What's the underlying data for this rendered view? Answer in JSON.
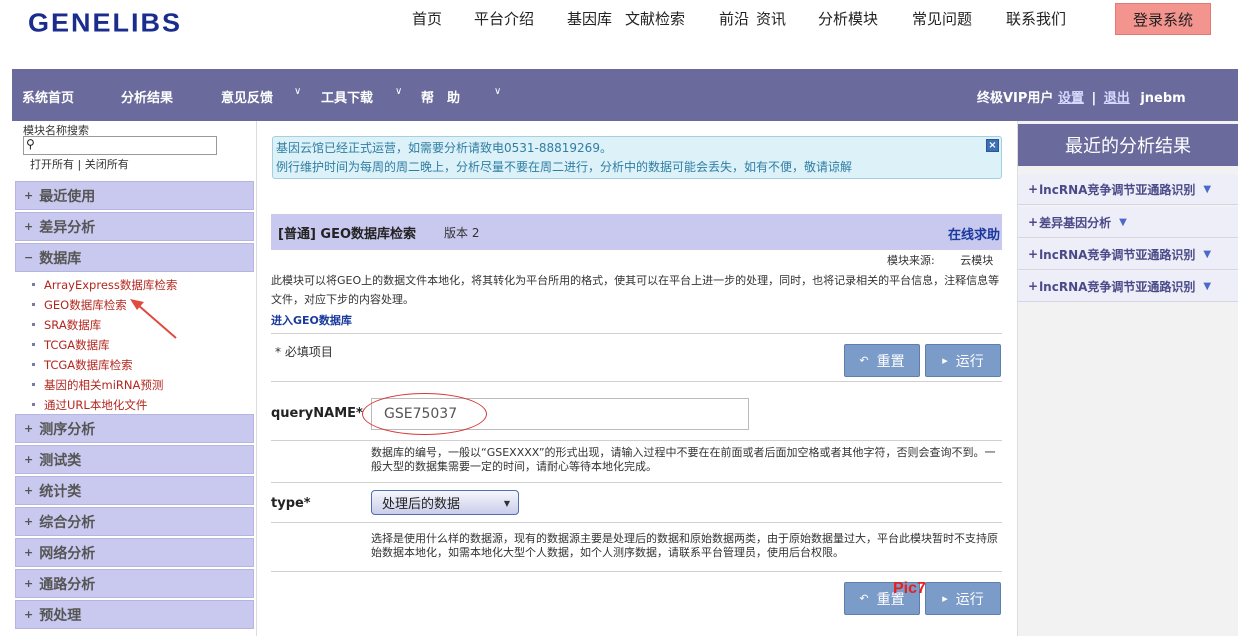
{
  "header": {
    "logo": "GENELIBS",
    "nav": [
      "首页",
      "平台介绍",
      "基因库",
      "文献检索",
      "前沿",
      "资讯",
      "分析模块",
      "常见问题",
      "联系我们"
    ],
    "login": "登录系统"
  },
  "navbar": {
    "items": [
      "系统首页",
      "分析结果",
      "意见反馈",
      "工具下载",
      "帮　助"
    ],
    "user_type": "终极VIP用户",
    "settings": "设置",
    "sep": "|",
    "logout": "退出",
    "username": "jnebm"
  },
  "sidebar": {
    "search_label": "模块名称搜索",
    "search_value": "",
    "open_all": "打开所有",
    "link_sep": " | ",
    "close_all": "关闭所有",
    "categories": {
      "recent": "最近使用",
      "diff": "差异分析",
      "db": "数据库",
      "seq": "测序分析",
      "test": "测试类",
      "stats": "统计类",
      "comp": "综合分析",
      "net": "网络分析",
      "path": "通路分析",
      "pre": "预处理"
    },
    "signs": {
      "closed": "+",
      "open": "−"
    },
    "db_items": [
      "ArrayExpress数据库检索",
      "GEO数据库检索",
      "SRA数据库",
      "TCGA数据库",
      "TCGA数据库检索",
      "基因的相关miRNA预测",
      "通过URL本地化文件"
    ]
  },
  "main": {
    "notice_line1": "基因云馆已经正式运营，如需要分析请致电0531-88819269。",
    "notice_line2": "例行维护时间为每周的周二晚上，分析尽量不要在周二进行，分析中的数据可能会丢失，如有不便，敬请谅解",
    "notice_close": "×",
    "module_title": "[普通] GEO数据库检索",
    "module_version": "版本 2",
    "help_link": "在线求助",
    "source_label": "模块来源:",
    "source_value": "云模块",
    "description": "此模块可以将GEO上的数据文件本地化，将其转化为平台所用的格式，使其可以在平台上进一步的处理，同时，也将记录相关的平台信息，注释信息等文件，对应下步的内容处理。",
    "enter_link": "进入GEO数据库",
    "required_note": "* 必填项目",
    "reset": "重置",
    "run": "运行",
    "reset_icon": "↶",
    "run_icon": "▸",
    "query_label": "queryNAME*",
    "query_value": "GSE75037",
    "query_help": "数据库的编号，一般以“GSEXXXX”的形式出现，请输入过程中不要在在前面或者后面加空格或者其他字符，否则会查询不到。一般大型的数据集需要一定的时间，请耐心等待本地化完成。",
    "type_label": "type*",
    "type_value": "处理后的数据",
    "type_help": "选择是使用什么样的数据源，现有的数据源主要是处理后的数据和原始数据两类，由于原始数据量过大，平台此模块暂时不支持原始数据本地化，如需本地化大型个人数据，如个人测序数据，请联系平台管理员，使用后台权限。",
    "pic_label": "Pic7"
  },
  "right_panel": {
    "title": "最近的分析结果",
    "plus": "+",
    "dropdown": "▼",
    "items": [
      "lncRNA竞争调节亚通路识别",
      "差异基因分析",
      "lncRNA竞争调节亚通路识别",
      "lncRNA竞争调节亚通路识别"
    ]
  },
  "colors": {
    "nav_purple": "#6a6a9c",
    "category_lavender": "#c9c9ef",
    "login_pink": "#f4948f",
    "button_blue": "#7b9bc9",
    "link_red": "#b3261e",
    "annotation_red": "#e8201d"
  },
  "icons": {
    "search": "magnifier-icon",
    "chevron": "chevron-down-icon",
    "arrow_annotation": "red-arrow-icon"
  }
}
